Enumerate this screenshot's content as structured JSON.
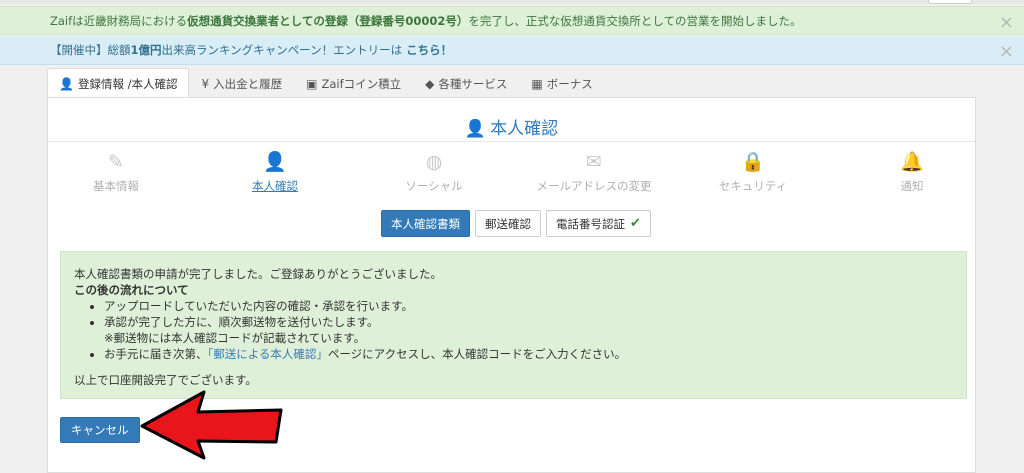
{
  "banners": {
    "registration": {
      "before": "Zaifは近畿財務局における",
      "strong": "仮想通貨交換業者としての登録（登録番号00002号）",
      "after": "を完了し、正式な仮想通貨交換所としての営業を開始しました。",
      "close": "×"
    },
    "campaign": {
      "before": "【開催中】総額",
      "strong": "1億円",
      "after": "出来高ランキングキャンペーン！エントリーは",
      "link": "こちら！",
      "close": "×"
    }
  },
  "tabs": [
    {
      "label": "登録情報 /本人確認",
      "icon": "user-icon",
      "glyph": "👤"
    },
    {
      "label": "入出金と履歴",
      "icon": "yen-icon",
      "glyph": "¥"
    },
    {
      "label": "Zaifコイン積立",
      "icon": "piggy-bank-icon",
      "glyph": "▣"
    },
    {
      "label": "各種サービス",
      "icon": "tags-icon",
      "glyph": "◆"
    },
    {
      "label": "ボーナス",
      "icon": "gift-icon",
      "glyph": "▦"
    }
  ],
  "panel": {
    "title": "本人確認",
    "title_icon": "👤",
    "steps": [
      {
        "label": "基本情報",
        "icon": "pencil-icon",
        "glyph": "✎"
      },
      {
        "label": "本人確認",
        "icon": "user-icon",
        "glyph": "👤"
      },
      {
        "label": "ソーシャル",
        "icon": "globe-icon",
        "glyph": "◍"
      },
      {
        "label": "メールアドレスの変更",
        "icon": "envelope-icon",
        "glyph": "✉"
      },
      {
        "label": "セキュリティ",
        "icon": "lock-icon",
        "glyph": "🔒"
      },
      {
        "label": "通知",
        "icon": "bell-icon",
        "glyph": "🔔"
      }
    ],
    "buttons": {
      "documents": "本人確認書類",
      "mail": "郵送確認",
      "phone": "電話番号認証",
      "phone_check": "✔"
    },
    "notice": {
      "line1": "本人確認書類の申請が完了しました。ご登録ありがとうございました。",
      "flow_title": "この後の流れについて",
      "items": [
        "アップロードしていただいた内容の確認・承認を行います。",
        "承認が完了した方に、順次郵送物を送付いたします。"
      ],
      "note": "※郵送物には本人確認コードが記載されています。",
      "item3_before": "お手元に届き次第、",
      "item3_link": "「郵送による本人確認」",
      "item3_after": "ページにアクセスし、本人確認コードをご入力ください。",
      "footer": "以上で口座開設完了でございます。"
    },
    "cancel_label": "キャンセル"
  },
  "colors": {
    "accent": "#337ab7",
    "success_bg": "#dff0d8",
    "info_bg": "#d9edf7",
    "arrow": "#e8151b"
  }
}
